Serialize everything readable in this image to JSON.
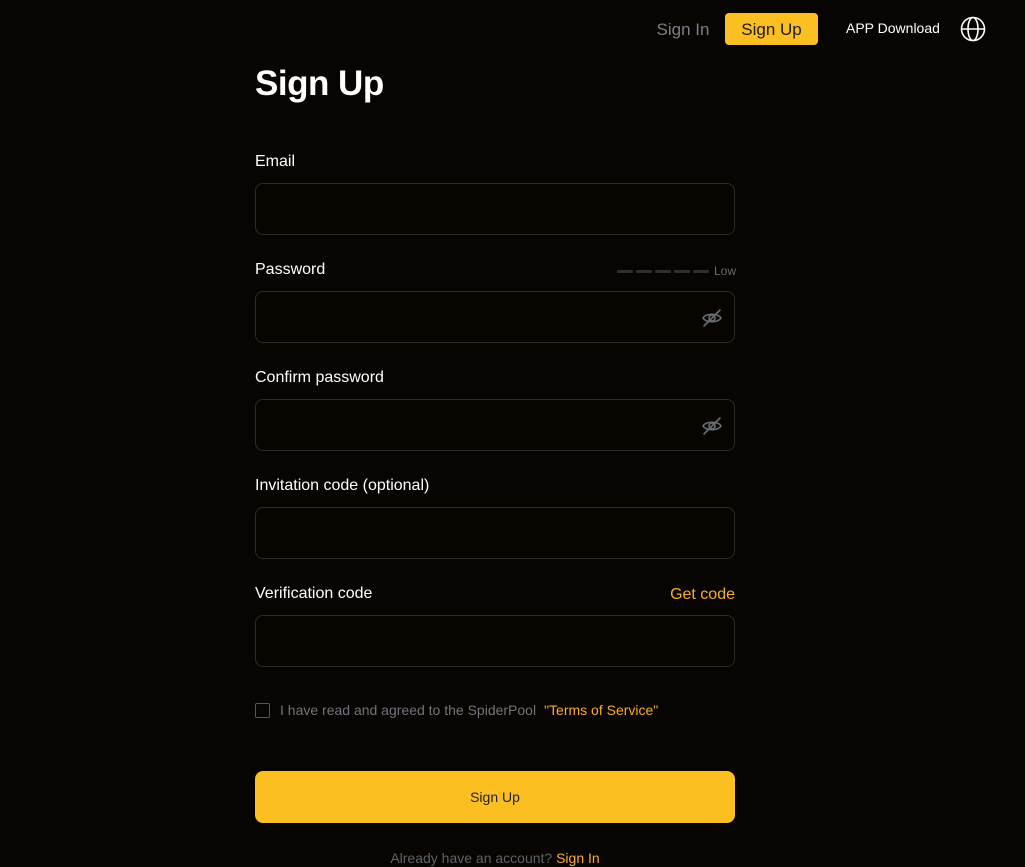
{
  "header": {
    "sign_in": "Sign In",
    "sign_up": "Sign Up",
    "app_download": "APP Download",
    "language_icon": "globe-icon"
  },
  "form": {
    "title": "Sign Up",
    "email": {
      "label": "Email",
      "value": "",
      "placeholder": ""
    },
    "password": {
      "label": "Password",
      "value": "",
      "placeholder": "",
      "strength_label": "Low",
      "strength_segments": 5,
      "strength_level": 0,
      "visibility_icon": "eye-off-icon"
    },
    "confirm_password": {
      "label": "Confirm password",
      "value": "",
      "placeholder": "",
      "visibility_icon": "eye-off-icon"
    },
    "invitation_code": {
      "label": "Invitation code (optional)",
      "value": "",
      "placeholder": ""
    },
    "verification_code": {
      "label": "Verification code",
      "get_code": "Get code",
      "value": "",
      "placeholder": ""
    },
    "agreement": {
      "checked": false,
      "text": "I have read and agreed to the SpiderPool",
      "terms_link": "\"Terms of Service\""
    },
    "submit_label": "Sign Up",
    "footer": {
      "prompt": "Already have an account?",
      "link": "Sign In"
    }
  },
  "colors": {
    "background": "#070401",
    "accent": "#fbbf22",
    "link": "#fbae27",
    "border": "#2e2c2a",
    "muted_text": "#71747a"
  }
}
